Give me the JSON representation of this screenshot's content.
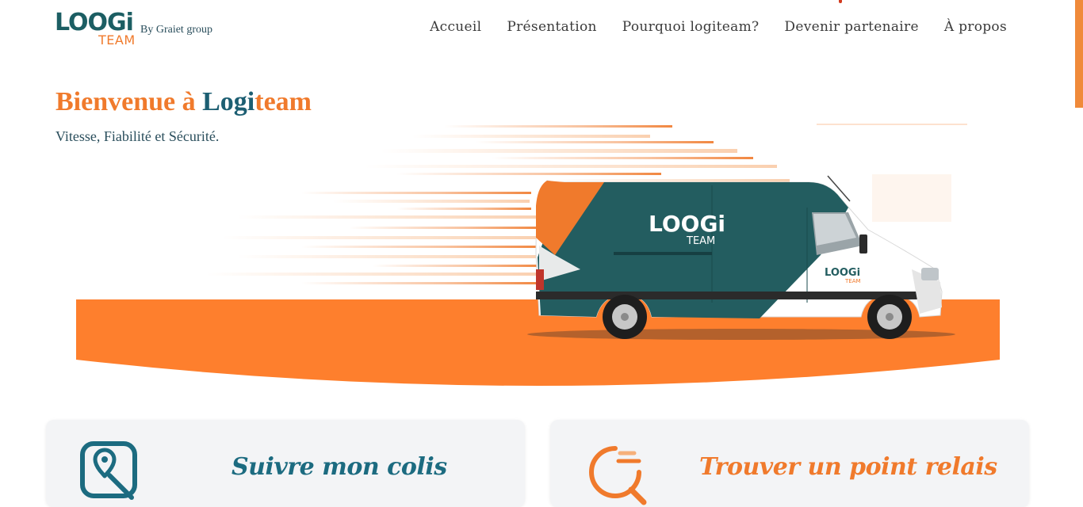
{
  "header": {
    "logo_text": "LOOGi",
    "logo_team": "TEAM",
    "logo_subtitle": "By Graiet group",
    "nav": [
      "Accueil",
      "Présentation",
      "Pourquoi logiteam?",
      "Devenir partenaire",
      "À propos"
    ]
  },
  "hero": {
    "title_part1": "Bienvenue à ",
    "title_part2": "Logi",
    "title_part3": "team",
    "subtitle": "Vitesse, Fiabilité et Sécurité.",
    "van_logo_text": "LOOGi",
    "van_logo_team": "TEAM"
  },
  "cards": [
    {
      "title": "Suivre mon colis",
      "icon": "map-pin-icon"
    },
    {
      "title": "Trouver un point relais",
      "icon": "magnifier-icon"
    }
  ],
  "colors": {
    "orange": "#f07a2c",
    "teal": "#1c5e63",
    "card_bg": "#f3f4f6"
  }
}
